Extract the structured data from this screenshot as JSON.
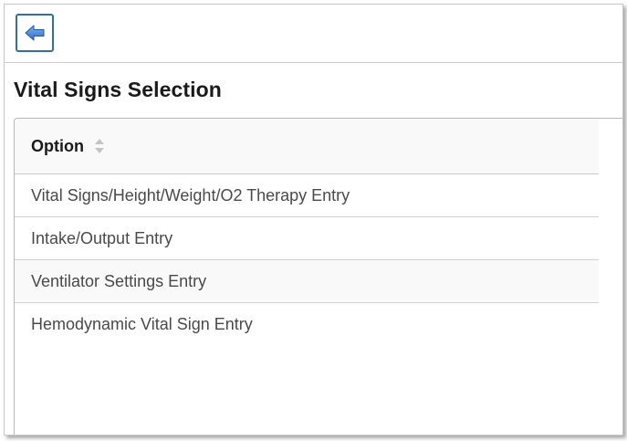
{
  "toolbar": {
    "back_icon": "back-arrow-icon",
    "accent_color": "#2f6db5"
  },
  "page": {
    "title": "Vital Signs Selection"
  },
  "table": {
    "header": {
      "label": "Option",
      "sort_icon": "sort-icon"
    },
    "rows": [
      {
        "label": "Vital Signs/Height/Weight/O2 Therapy Entry"
      },
      {
        "label": "Intake/Output Entry"
      },
      {
        "label": "Ventilator Settings Entry"
      },
      {
        "label": "Hemodynamic Vital Sign Entry"
      }
    ]
  }
}
